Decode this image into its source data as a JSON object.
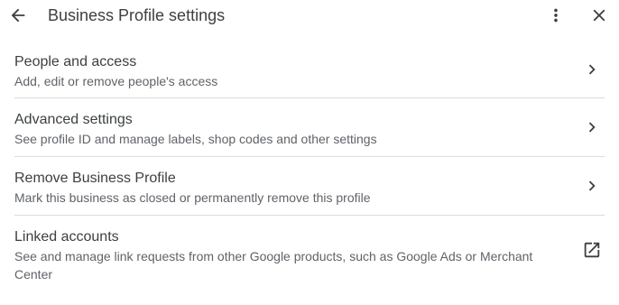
{
  "header": {
    "title": "Business Profile settings",
    "back_icon": "arrow-back-icon",
    "more_icon": "more-vert-icon",
    "close_icon": "close-icon"
  },
  "items": [
    {
      "title": "People and access",
      "description": "Add, edit or remove people's access",
      "trailing_icon": "chevron-right-icon"
    },
    {
      "title": "Advanced settings",
      "description": "See profile ID and manage labels, shop codes and other settings",
      "trailing_icon": "chevron-right-icon"
    },
    {
      "title": "Remove Business Profile",
      "description": "Mark this business as closed or permanently remove this profile",
      "trailing_icon": "chevron-right-icon"
    },
    {
      "title": "Linked accounts",
      "description": "See and manage link requests from other Google products, such as Google Ads or Merchant Center",
      "trailing_icon": "open-in-new-icon"
    }
  ],
  "colors": {
    "text_primary": "#3c4043",
    "text_secondary": "#5f6368",
    "divider": "#dadce0",
    "icon": "#3c4043"
  }
}
